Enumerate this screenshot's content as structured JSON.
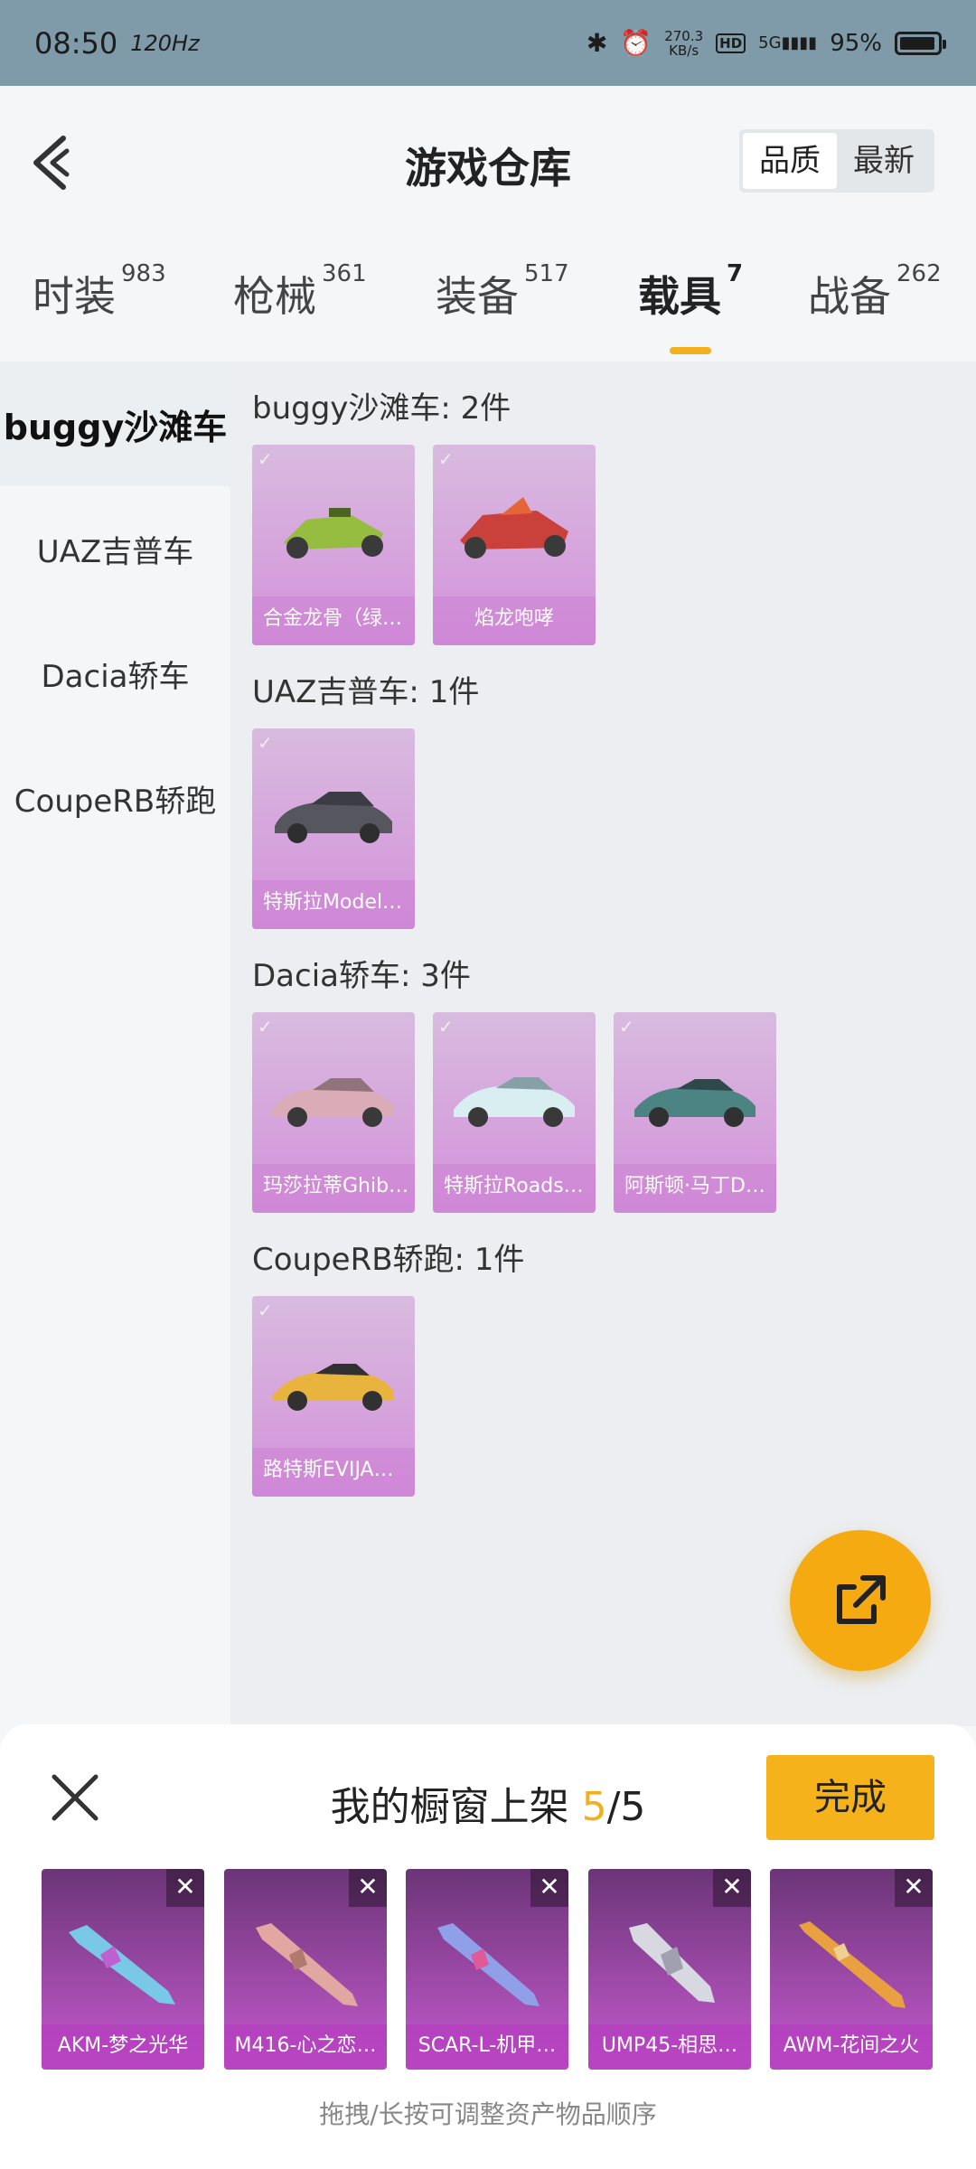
{
  "status_bar": {
    "time": "08:50",
    "refresh": "120Hz",
    "speed_value": "270.3",
    "speed_unit": "KB/s",
    "hd": "HD",
    "network": "5G",
    "battery": "95%"
  },
  "header": {
    "title": "游戏仓库",
    "sort_quality": "品质",
    "sort_newest": "最新"
  },
  "tabs": [
    {
      "label": "时装",
      "count": "983"
    },
    {
      "label": "枪械",
      "count": "361"
    },
    {
      "label": "装备",
      "count": "517"
    },
    {
      "label": "载具",
      "count": "7"
    },
    {
      "label": "战备",
      "count": "262"
    }
  ],
  "sidebar": [
    {
      "label": "buggy沙滩车"
    },
    {
      "label": "UAZ吉普车"
    },
    {
      "label": "Dacia轿车"
    },
    {
      "label": "CoupeRB轿跑"
    }
  ],
  "sections": [
    {
      "title": "buggy沙滩车: 2件",
      "items": [
        "合金龙骨（绿…",
        "焰龙咆哮"
      ]
    },
    {
      "title": "UAZ吉普车: 1件",
      "items": [
        "特斯拉Model…"
      ]
    },
    {
      "title": "Dacia轿车: 3件",
      "items": [
        "玛莎拉蒂Ghib…",
        "特斯拉Roads…",
        "阿斯顿·马丁D…"
      ]
    },
    {
      "title": "CoupeRB轿跑: 1件",
      "items": [
        "路特斯EVIJA…"
      ]
    }
  ],
  "panel": {
    "title_prefix": "我的橱窗上架 ",
    "count": "5",
    "total": "/5",
    "done": "完成",
    "close_icon": "close-icon",
    "items": [
      "AKM-梦之光华",
      "M416-心之恋…",
      "SCAR-L-机甲…",
      "UMP45-相思…",
      "AWM-花间之火"
    ],
    "hint": "拖拽/长按可调整资产物品顺序"
  },
  "colors": {
    "accent": "#f2b01e",
    "card_purple": "#d38ad9",
    "weapon_purple": "#c65ad0"
  }
}
